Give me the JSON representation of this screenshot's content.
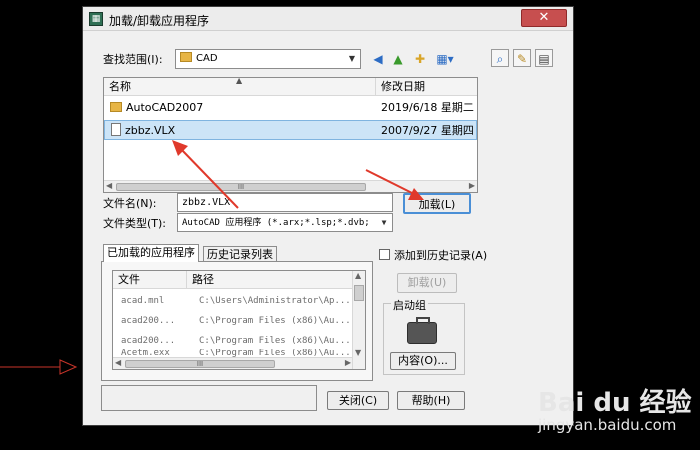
{
  "window": {
    "title": "加载/卸载应用程序",
    "app_icon": "cad-app-icon",
    "close_symbol": "✕"
  },
  "lookin": {
    "label": "查找范围(I):",
    "value": "CAD"
  },
  "toolbar": {
    "back_icon": "back-icon",
    "up_icon": "up-folder-icon",
    "new_folder_icon": "new-folder-icon",
    "views_icon": "views-menu-icon",
    "find_icon": "find-icon",
    "tools_icon": "tools-icon"
  },
  "file_list": {
    "columns": [
      "名称",
      "修改日期"
    ],
    "rows": [
      {
        "name": "AutoCAD2007",
        "date": "2019/6/18 星期二 2",
        "type": "folder"
      },
      {
        "name": "zbbz.VLX",
        "date": "2007/9/27 星期四 1",
        "type": "file",
        "selected": true
      }
    ],
    "scroll_grip": "III"
  },
  "filename": {
    "label": "文件名(N):",
    "value": "zbbz.VLX"
  },
  "filetype": {
    "label": "文件类型(T):",
    "value": "AutoCAD 应用程序 (*.arx;*.lsp;*.dvb;"
  },
  "load_button": "加载(L)",
  "tabs": [
    "已加载的应用程序",
    "历史记录列表"
  ],
  "loaded_apps": {
    "columns": [
      "文件",
      "路径"
    ],
    "rows": [
      {
        "file": "acad.mnl",
        "path": "C:\\Users\\Administrator\\Ap..."
      },
      {
        "file": "acad200...",
        "path": "C:\\Program Files (x86)\\Au..."
      },
      {
        "file": "acad200...",
        "path": "C:\\Program Files (x86)\\Au..."
      },
      {
        "file": "Acetm.exx",
        "path": "C:\\Program Files (x86)\\Au..."
      }
    ],
    "scroll_grip": "III"
  },
  "add_history": {
    "label": "添加到历史记录(A)"
  },
  "unload_button": "卸载(U)",
  "startup": {
    "label": "启动组",
    "contents_button": "内容(O)..."
  },
  "close_button": "关闭(C)",
  "help_button": "帮助(H)",
  "watermark": {
    "brand": "Bai du 经验",
    "url": "jingyan.baidu.com"
  },
  "colors": {
    "annotation_arrow": "#e0392b",
    "selection": "#cce4f7",
    "dialog_bg": "#f0f0f0"
  }
}
